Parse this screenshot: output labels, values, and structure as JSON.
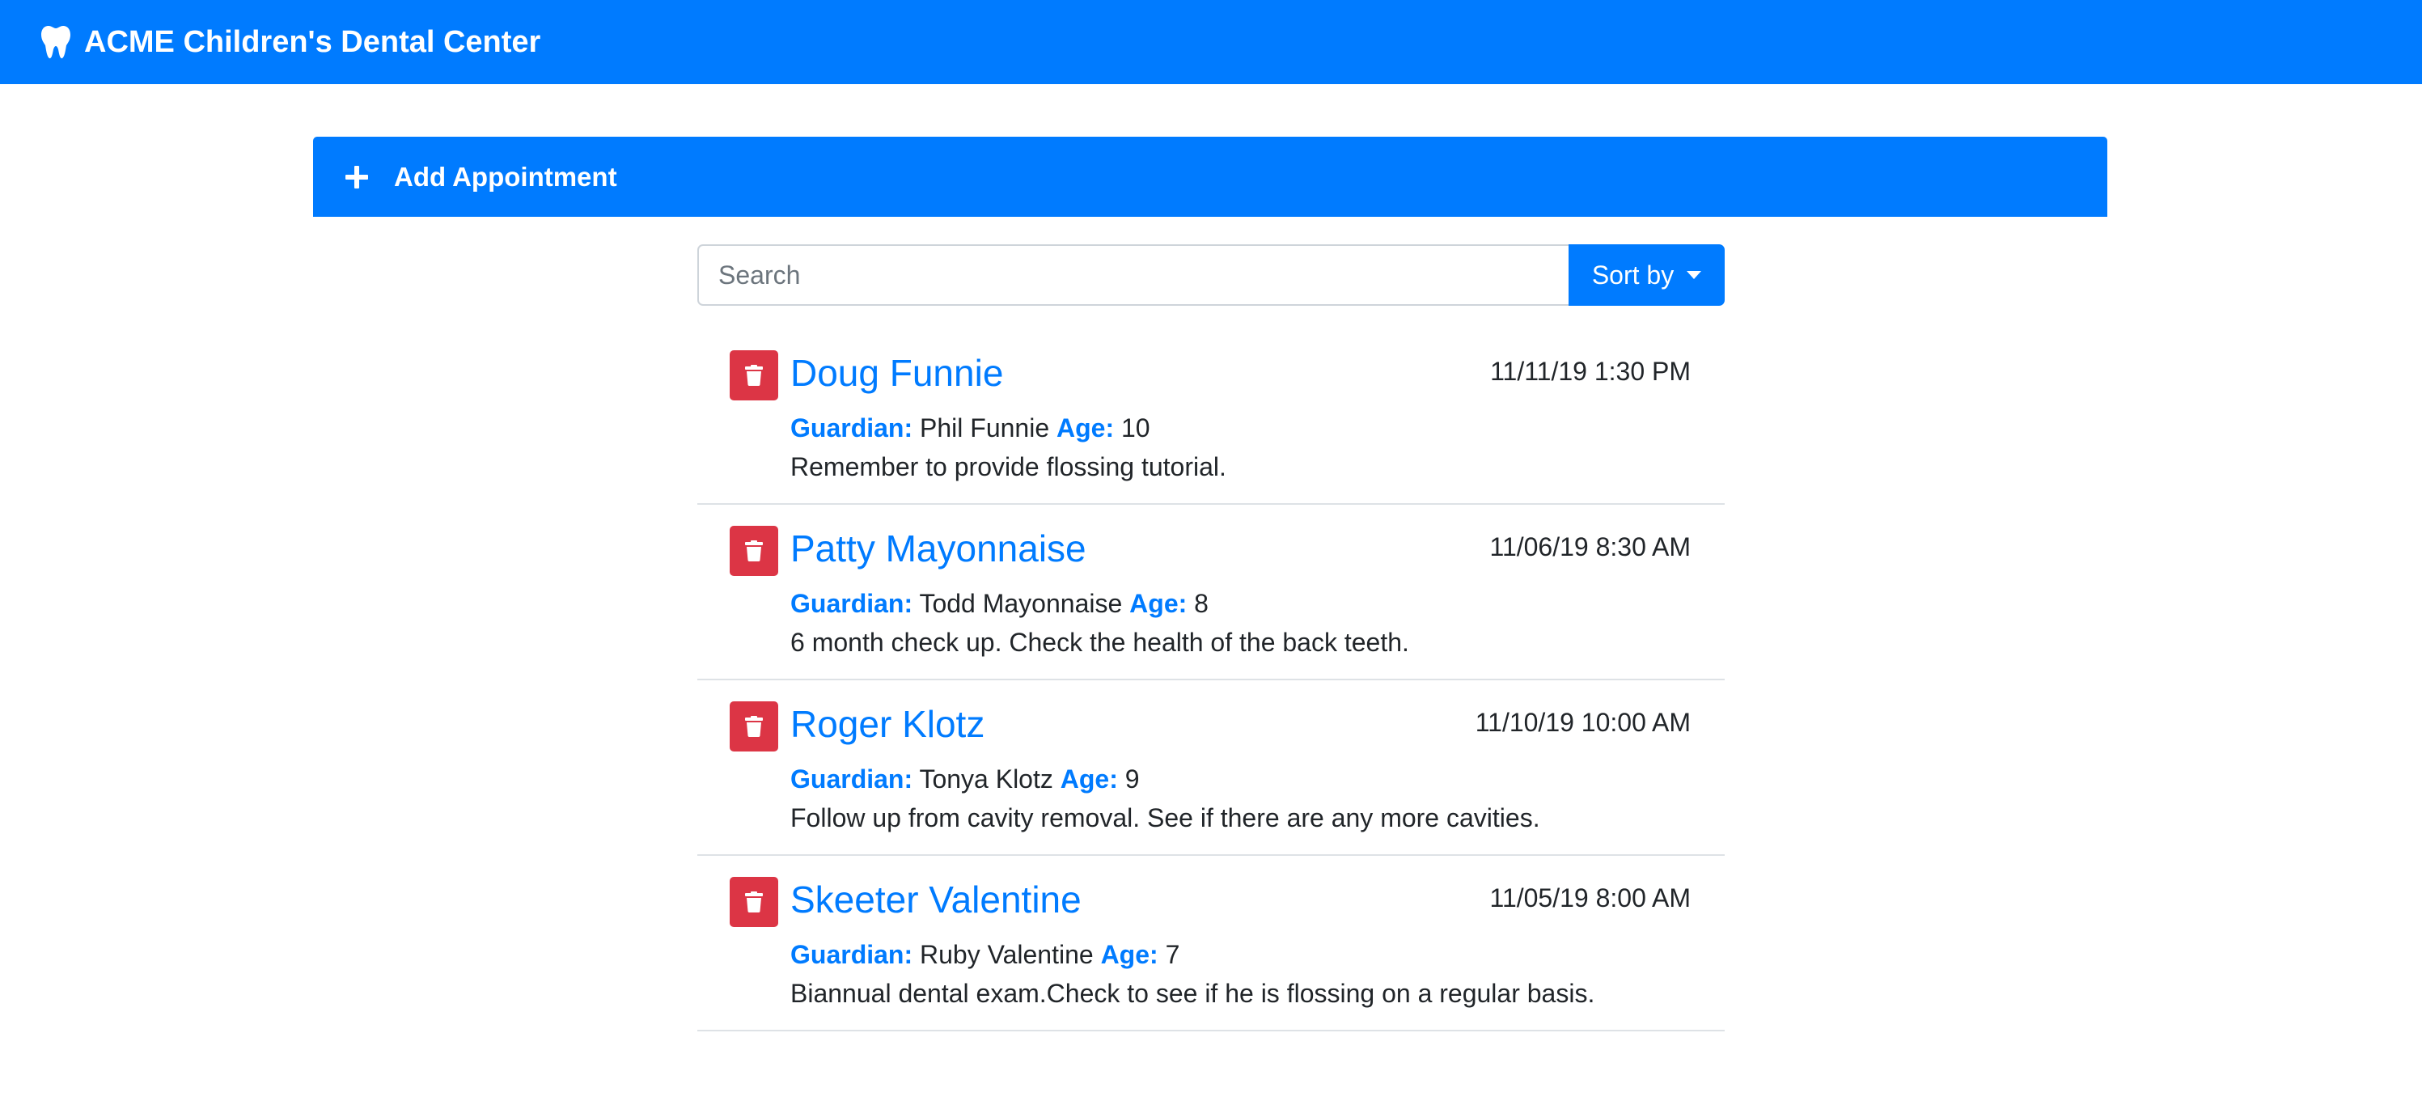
{
  "navbar": {
    "brand": "ACME Children's Dental Center",
    "icon": "tooth-icon"
  },
  "add_appointment": {
    "label": "Add Appointment",
    "icon": "plus-icon"
  },
  "search": {
    "placeholder": "Search",
    "value": ""
  },
  "sort": {
    "label": "Sort by"
  },
  "labels": {
    "guardian": "Guardian:",
    "age": "Age:"
  },
  "appointments": [
    {
      "name": "Doug Funnie",
      "date": "11/11/19 1:30 PM",
      "guardian": "Phil Funnie",
      "age": "10",
      "notes": "Remember to provide flossing tutorial."
    },
    {
      "name": "Patty Mayonnaise",
      "date": "11/06/19 8:30 AM",
      "guardian": "Todd Mayonnaise",
      "age": "8",
      "notes": "6 month check up. Check the health of the back teeth."
    },
    {
      "name": "Roger Klotz",
      "date": "11/10/19 10:00 AM",
      "guardian": "Tonya Klotz",
      "age": "9",
      "notes": "Follow up from cavity removal. See if there are any more cavities."
    },
    {
      "name": "Skeeter Valentine",
      "date": "11/05/19 8:00 AM",
      "guardian": "Ruby Valentine",
      "age": "7",
      "notes": "Biannual dental exam.Check to see if he is flossing on a regular basis."
    }
  ],
  "colors": {
    "primary": "#007bff",
    "danger": "#dc3545",
    "divider": "#dee2e6"
  }
}
